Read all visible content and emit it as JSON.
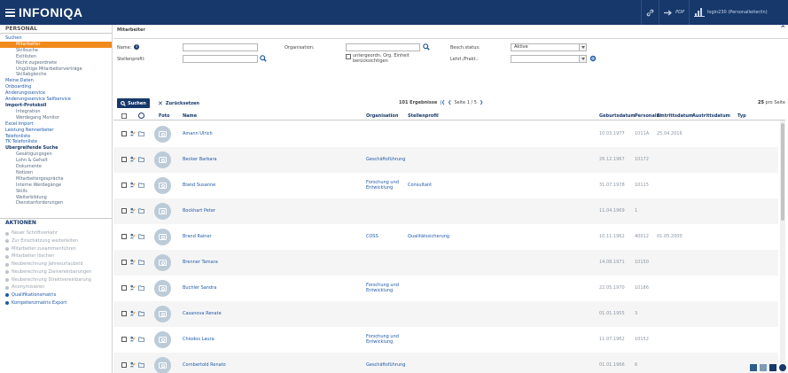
{
  "header": {
    "logo": "INFONIQA",
    "user_pdp": "PDP",
    "user_name": "login230 (Personalleiter/in)"
  },
  "sidebar": {
    "title": "PERSONAL",
    "items": [
      {
        "label": "Suchen",
        "level": 0,
        "bold": false
      },
      {
        "label": "Mitarbeiter",
        "level": 1,
        "active": true
      },
      {
        "label": "Skillsuche",
        "level": 1
      },
      {
        "label": "Exitlisten",
        "level": 1
      },
      {
        "label": "Nicht zugeordnete",
        "level": 1
      },
      {
        "label": "Ungültige Mitarbeiterverträge",
        "level": 1
      },
      {
        "label": "Skillabgleiche",
        "level": 1
      },
      {
        "label": "Meine Daten",
        "level": 0
      },
      {
        "label": "Onboarding",
        "level": 0
      },
      {
        "label": "Änderungsservice",
        "level": 0
      },
      {
        "label": "Änderungsservice Selfservice",
        "level": 0
      },
      {
        "label": "Import-Protokoll",
        "level": 0,
        "bold": true
      },
      {
        "label": "Integration",
        "level": 1
      },
      {
        "label": "Werdegang Monitor",
        "level": 1
      },
      {
        "label": "Excel Import",
        "level": 0
      },
      {
        "label": "Leistung Nennerbeter",
        "level": 0
      },
      {
        "label": "Telefonliste",
        "level": 0
      },
      {
        "label": "TK Telefonliste",
        "level": 0
      },
      {
        "label": "Übergreifende Suche",
        "level": 0,
        "bold": true
      },
      {
        "label": "Gesätigungsgen",
        "level": 1
      },
      {
        "label": "Lohn & Gehalt",
        "level": 1
      },
      {
        "label": "Dokumente",
        "level": 1
      },
      {
        "label": "Notizen",
        "level": 1
      },
      {
        "label": "Mitarbeitergespräche",
        "level": 1
      },
      {
        "label": "Interne Werdegänge",
        "level": 1
      },
      {
        "label": "Skills",
        "level": 1
      },
      {
        "label": "Weiterbildung",
        "level": 1
      },
      {
        "label": "Dienstanforderungen",
        "level": 1
      }
    ],
    "actions_title": "AKTIONEN",
    "actions": [
      {
        "label": "Neuer Schriftverkehr",
        "on": false
      },
      {
        "label": "Zur Einschätzung weiterleiten",
        "on": false
      },
      {
        "label": "Mitarbeiter zusammenführen",
        "on": false
      },
      {
        "label": "Mitarbeiter löschen",
        "on": false
      },
      {
        "label": "Neuberechnung Jahresurlaubstd",
        "on": false
      },
      {
        "label": "Neuberechnung Zielvereinbarungen",
        "on": false
      },
      {
        "label": "Neuberechnung Direktvereinbarung",
        "on": false
      },
      {
        "label": "Anonymisieren",
        "on": false
      },
      {
        "label": "Qualifikationsmatrix",
        "on": true
      },
      {
        "label": "Kompetenzmatrix Export",
        "on": true
      }
    ]
  },
  "main": {
    "breadcrumb": "Mitarbeiter",
    "filters": {
      "name_label": "Name:",
      "stellenprofil_label": "Stellenprofil:",
      "organisation_label": "Organisation:",
      "untergeordnete_label": "untergeordn. Org. Einheit berücksichtigen",
      "beschaeftigung_label": "Besch.status:",
      "beschaeftigung_value": "Aktive",
      "lehre_label": "Lehrl./Prakt.:",
      "lehre_value": ""
    },
    "search_button": "Suchen",
    "reset_button": "Zurücksetzen",
    "pager": {
      "results": "101 Ergebnisse",
      "page": "Seite 1 / 5"
    },
    "per_page": {
      "value": "25",
      "label": "pro Seite"
    },
    "columns": {
      "foto": "Foto",
      "name": "Name",
      "organisation": "Organisation",
      "stellenprofil": "Stellenprofil",
      "geburtsdatum": "Geburtsdatum",
      "personalnr": "Personalnr.",
      "eintritt": "Eintrittsdatum",
      "austritt": "Austrittsdatum",
      "typ": "Typ"
    },
    "rows": [
      {
        "name": "Amann Ulrich",
        "org": "",
        "stelle": "",
        "geb": "10.03.1977",
        "pnr": "1011A",
        "ein": "25.04.2016"
      },
      {
        "name": "Becker Barbara",
        "org": "Geschäftsführung",
        "stelle": "",
        "geb": "26.12.1967",
        "pnr": "10172",
        "ein": ""
      },
      {
        "name": "Bland Susanne",
        "org": "Forschung und Entwicklung",
        "stelle": "Consultant",
        "geb": "31.07.1978",
        "pnr": "10115",
        "ein": ""
      },
      {
        "name": "Bockhart Peter",
        "org": "",
        "stelle": "",
        "geb": "11.04.1969",
        "pnr": "1",
        "ein": ""
      },
      {
        "name": "Brand Rainer",
        "org": "COSS",
        "stelle": "Qualitätssicherung",
        "geb": "10.11.1962",
        "pnr": "40012",
        "ein": "01.05.2000"
      },
      {
        "name": "Brenner Tamara",
        "org": "",
        "stelle": "",
        "geb": "14.08.1971",
        "pnr": "10150",
        "ein": ""
      },
      {
        "name": "Buchler Sandra",
        "org": "Forschung und Entwicklung",
        "stelle": "",
        "geb": "22.05.1970",
        "pnr": "10186",
        "ein": ""
      },
      {
        "name": "Casanova Renate",
        "org": "",
        "stelle": "",
        "geb": "01.01.1955",
        "pnr": "3",
        "ein": ""
      },
      {
        "name": "Chiodos Laura",
        "org": "Forschung und Entwicklung",
        "stelle": "",
        "geb": "11.07.1962",
        "pnr": "10152",
        "ein": ""
      },
      {
        "name": "Cornbertold Renato",
        "org": "Geschäftsführung",
        "stelle": "",
        "geb": "01.01.1966",
        "pnr": "6",
        "ein": ""
      }
    ]
  },
  "colors": {
    "header_bg": "#16386a",
    "accent_orange": "#f08a1c",
    "link_blue": "#1e5aa8"
  }
}
